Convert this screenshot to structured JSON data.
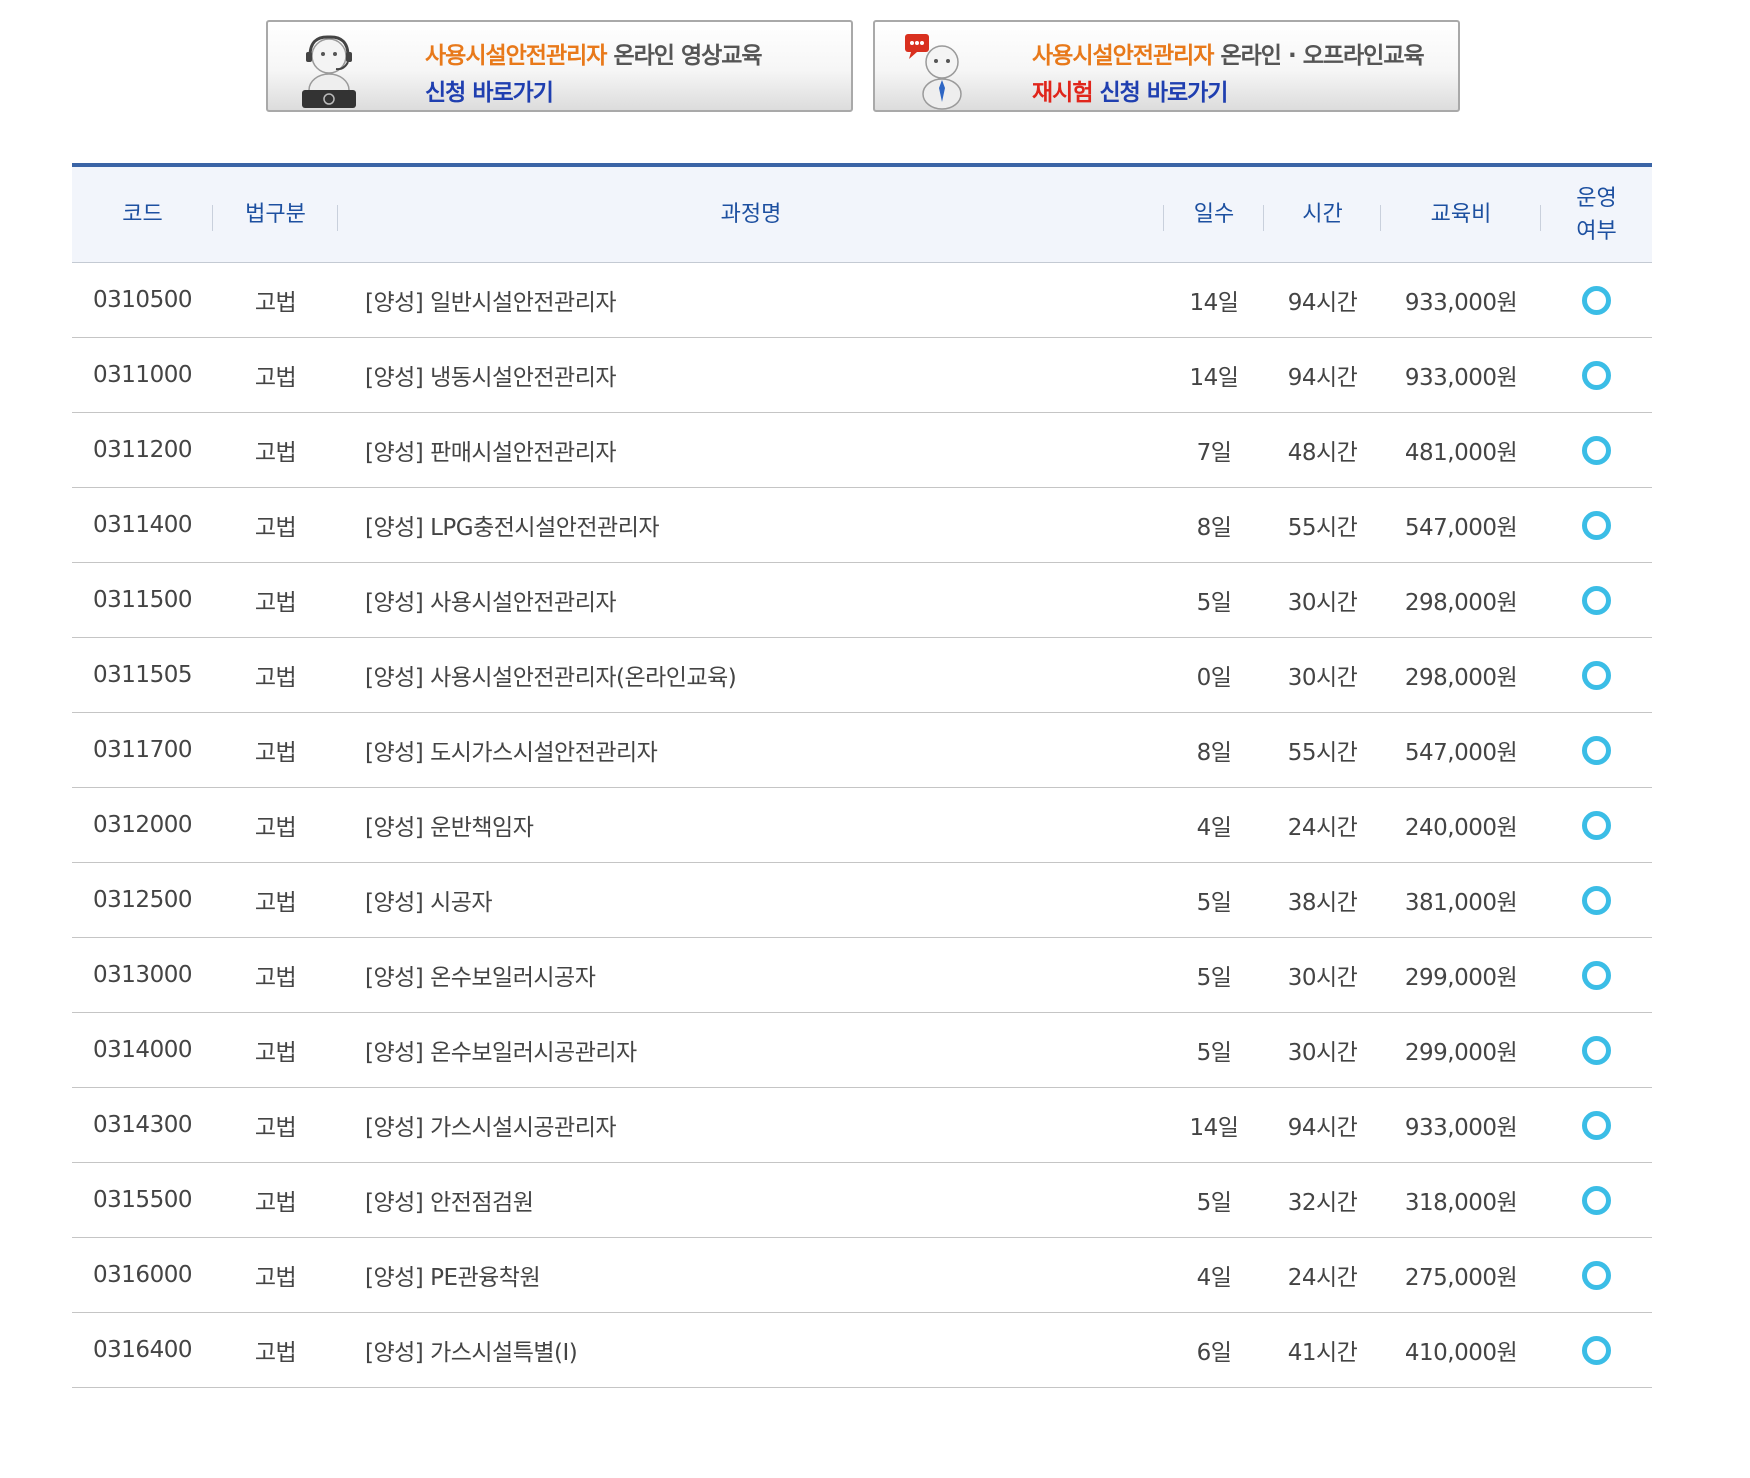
{
  "banners": [
    {
      "line1_orange": "사용시설안전관리자",
      "line1_dark": "온라인 영상교육",
      "line2_red": "",
      "line2_navy": "신청 바로가기",
      "icon": "operator-mascot-icon"
    },
    {
      "line1_orange": "사용시설안전관리자",
      "line1_dark": "온라인 · 오프라인교육",
      "line2_red": "재시험",
      "line2_navy": "신청 바로가기",
      "icon": "chat-mascot-icon"
    }
  ],
  "table": {
    "headers": {
      "code": "코드",
      "law": "법구분",
      "name": "과정명",
      "days": "일수",
      "hours": "시간",
      "fee": "교육비",
      "op_line1": "운영",
      "op_line2": "여부"
    },
    "rows": [
      {
        "code": "0310500",
        "law": "고법",
        "name": "[양성] 일반시설안전관리자",
        "days": "14일",
        "hours": "94시간",
        "fee": "933,000원"
      },
      {
        "code": "0311000",
        "law": "고법",
        "name": "[양성] 냉동시설안전관리자",
        "days": "14일",
        "hours": "94시간",
        "fee": "933,000원"
      },
      {
        "code": "0311200",
        "law": "고법",
        "name": "[양성] 판매시설안전관리자",
        "days": "7일",
        "hours": "48시간",
        "fee": "481,000원"
      },
      {
        "code": "0311400",
        "law": "고법",
        "name": "[양성] LPG충전시설안전관리자",
        "days": "8일",
        "hours": "55시간",
        "fee": "547,000원"
      },
      {
        "code": "0311500",
        "law": "고법",
        "name": "[양성] 사용시설안전관리자",
        "days": "5일",
        "hours": "30시간",
        "fee": "298,000원"
      },
      {
        "code": "0311505",
        "law": "고법",
        "name": "[양성] 사용시설안전관리자(온라인교육)",
        "days": "0일",
        "hours": "30시간",
        "fee": "298,000원"
      },
      {
        "code": "0311700",
        "law": "고법",
        "name": "[양성] 도시가스시설안전관리자",
        "days": "8일",
        "hours": "55시간",
        "fee": "547,000원"
      },
      {
        "code": "0312000",
        "law": "고법",
        "name": "[양성] 운반책임자",
        "days": "4일",
        "hours": "24시간",
        "fee": "240,000원"
      },
      {
        "code": "0312500",
        "law": "고법",
        "name": "[양성] 시공자",
        "days": "5일",
        "hours": "38시간",
        "fee": "381,000원"
      },
      {
        "code": "0313000",
        "law": "고법",
        "name": "[양성] 온수보일러시공자",
        "days": "5일",
        "hours": "30시간",
        "fee": "299,000원"
      },
      {
        "code": "0314000",
        "law": "고법",
        "name": "[양성] 온수보일러시공관리자",
        "days": "5일",
        "hours": "30시간",
        "fee": "299,000원"
      },
      {
        "code": "0314300",
        "law": "고법",
        "name": "[양성] 가스시설시공관리자",
        "days": "14일",
        "hours": "94시간",
        "fee": "933,000원"
      },
      {
        "code": "0315500",
        "law": "고법",
        "name": "[양성] 안전점검원",
        "days": "5일",
        "hours": "32시간",
        "fee": "318,000원"
      },
      {
        "code": "0316000",
        "law": "고법",
        "name": "[양성] PE관융착원",
        "days": "4일",
        "hours": "24시간",
        "fee": "275,000원"
      },
      {
        "code": "0316400",
        "law": "고법",
        "name": "[양성] 가스시설특별(I)",
        "days": "6일",
        "hours": "41시간",
        "fee": "410,000원"
      }
    ],
    "operating_icon": "circle-o-icon",
    "operating_color": "#3bbde6"
  }
}
